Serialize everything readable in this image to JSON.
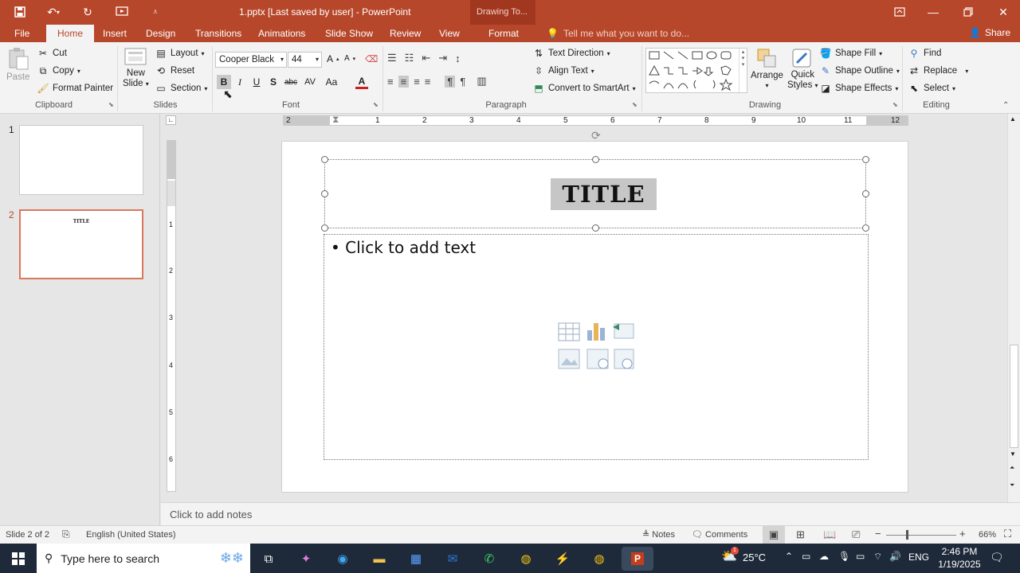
{
  "titlebar": {
    "doc_title": "1.pptx [Last saved by user] - PowerPoint",
    "context_tab_group": "Drawing To..."
  },
  "tabs": [
    {
      "label": "File"
    },
    {
      "label": "Home"
    },
    {
      "label": "Insert"
    },
    {
      "label": "Design"
    },
    {
      "label": "Transitions"
    },
    {
      "label": "Animations"
    },
    {
      "label": "Slide Show"
    },
    {
      "label": "Review"
    },
    {
      "label": "View"
    },
    {
      "label": "Format"
    }
  ],
  "tell_me": "Tell me what you want to do...",
  "share": "Share",
  "clipboard": {
    "paste": "Paste",
    "cut": "Cut",
    "copy": "Copy",
    "format_painter": "Format Painter",
    "label": "Clipboard"
  },
  "slides_group": {
    "new_slide_1": "New",
    "new_slide_2": "Slide",
    "layout": "Layout",
    "reset": "Reset",
    "section": "Section",
    "label": "Slides"
  },
  "font": {
    "name": "Cooper Black",
    "size": "44",
    "label": "Font",
    "bold": "B",
    "italic": "I",
    "underline": "U",
    "shadow": "S",
    "strike": "abc",
    "spacing": "AV",
    "case": "Aa",
    "color": "A"
  },
  "paragraph": {
    "text_direction": "Text Direction",
    "align_text": "Align Text",
    "convert_smartart": "Convert to SmartArt",
    "label": "Paragraph"
  },
  "drawing": {
    "arrange": "Arrange",
    "quick_1": "Quick",
    "quick_2": "Styles",
    "shape_fill": "Shape Fill",
    "shape_outline": "Shape Outline",
    "shape_effects": "Shape Effects",
    "label": "Drawing"
  },
  "editing": {
    "find": "Find",
    "replace": "Replace",
    "select": "Select",
    "label": "Editing"
  },
  "ruler": {
    "h_ticks": [
      "2",
      "1",
      "1",
      "2",
      "3",
      "4",
      "5",
      "6",
      "7",
      "8",
      "9",
      "10",
      "11",
      "12"
    ],
    "v_ticks": [
      "1",
      "2",
      "3",
      "4",
      "5",
      "6"
    ]
  },
  "thumbnails": [
    {
      "num": "1",
      "title": ""
    },
    {
      "num": "2",
      "title": "TITLE"
    }
  ],
  "slide": {
    "title": "TITLE",
    "body_placeholder": "Click to add text"
  },
  "notes_placeholder": "Click to add notes",
  "status": {
    "slide_info": "Slide 2 of 2",
    "language": "English (United States)",
    "notes": "Notes",
    "comments": "Comments",
    "zoom": "66%"
  },
  "taskbar": {
    "search": "Type here to search",
    "temp": "25°C",
    "lang": "ENG",
    "time": "2:46 PM",
    "date": "1/19/2025",
    "weather_badge": "1"
  },
  "colors": {
    "accent": "#b7472a",
    "selection": "#d9785a"
  }
}
